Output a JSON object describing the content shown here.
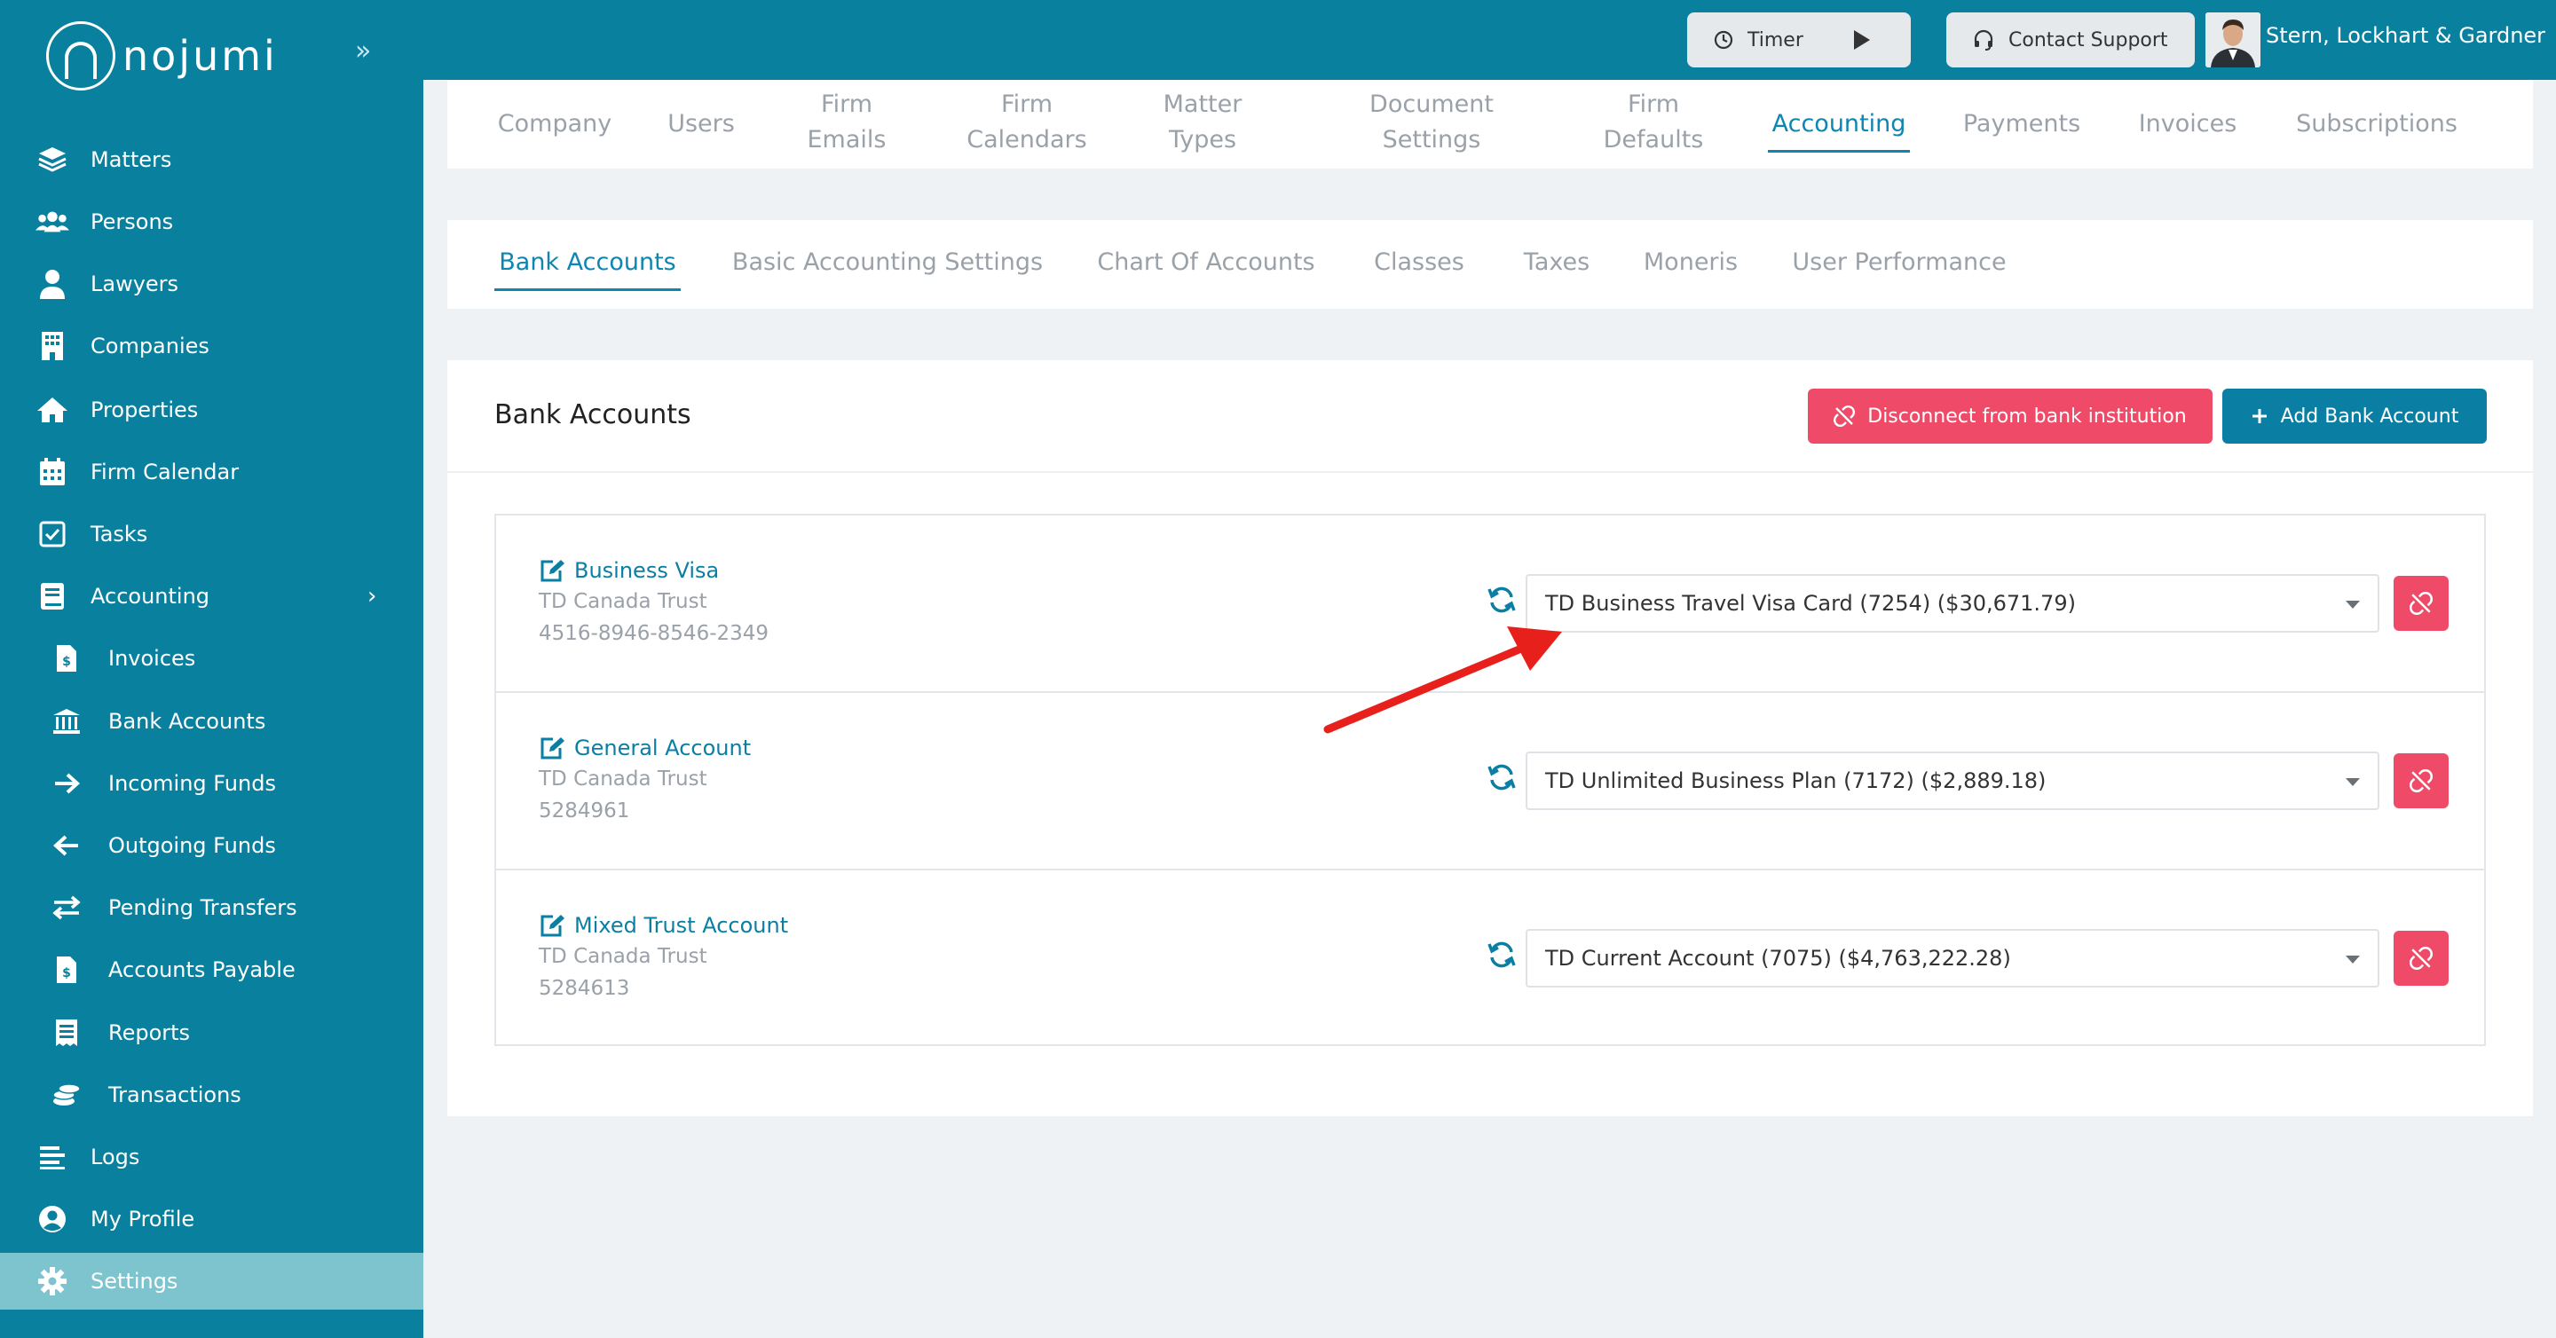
{
  "brand": {
    "logo_text": "nojumi"
  },
  "sidebar": {
    "items": [
      {
        "label": "Matters",
        "icon": "layers-icon"
      },
      {
        "label": "Persons",
        "icon": "users-icon"
      },
      {
        "label": "Lawyers",
        "icon": "lawyer-icon"
      },
      {
        "label": "Companies",
        "icon": "building-icon"
      },
      {
        "label": "Properties",
        "icon": "home-icon"
      },
      {
        "label": "Firm Calendar",
        "icon": "calendar-icon"
      },
      {
        "label": "Tasks",
        "icon": "checkbox-icon"
      },
      {
        "label": "Accounting",
        "icon": "book-icon"
      },
      {
        "label": "Invoices",
        "icon": "invoice-icon"
      },
      {
        "label": "Bank Accounts",
        "icon": "bank-icon"
      },
      {
        "label": "Incoming Funds",
        "icon": "arrow-right-icon"
      },
      {
        "label": "Outgoing Funds",
        "icon": "arrow-left-icon"
      },
      {
        "label": "Pending Transfers",
        "icon": "transfer-icon"
      },
      {
        "label": "Accounts Payable",
        "icon": "payable-icon"
      },
      {
        "label": "Reports",
        "icon": "receipt-icon"
      },
      {
        "label": "Transactions",
        "icon": "coins-icon"
      },
      {
        "label": "Logs",
        "icon": "list-icon"
      },
      {
        "label": "My Profile",
        "icon": "profile-icon"
      },
      {
        "label": "Settings",
        "icon": "gear-icon"
      }
    ]
  },
  "topbar": {
    "timer_label": "Timer",
    "support_label": "Contact Support",
    "firm_name": "Stern, Lockhart & Gardner"
  },
  "settings_tabs": [
    {
      "line1": "Company",
      "line2": ""
    },
    {
      "line1": "Users",
      "line2": ""
    },
    {
      "line1": "Firm",
      "line2": "Emails"
    },
    {
      "line1": "Firm",
      "line2": "Calendars"
    },
    {
      "line1": "Matter",
      "line2": "Types"
    },
    {
      "line1": "Document",
      "line2": "Settings"
    },
    {
      "line1": "Firm",
      "line2": "Defaults"
    },
    {
      "line1": "Accounting",
      "line2": ""
    },
    {
      "line1": "Payments",
      "line2": ""
    },
    {
      "line1": "Invoices",
      "line2": ""
    },
    {
      "line1": "Subscriptions",
      "line2": ""
    }
  ],
  "accounting_tabs": [
    "Bank Accounts",
    "Basic Accounting Settings",
    "Chart Of Accounts",
    "Classes",
    "Taxes",
    "Moneris",
    "User Performance"
  ],
  "main": {
    "title": "Bank Accounts",
    "disconnect_label": "Disconnect from bank institution",
    "add_label": "Add Bank Account"
  },
  "accounts": [
    {
      "name": "Business Visa",
      "bank": "TD Canada Trust",
      "number": "4516-8946-8546-2349",
      "linked": "TD Business Travel Visa Card (7254) ($30,671.79)"
    },
    {
      "name": "General Account",
      "bank": "TD Canada Trust",
      "number": "5284961",
      "linked": "TD Unlimited Business Plan (7172) ($2,889.18)"
    },
    {
      "name": "Mixed Trust Account",
      "bank": "TD Canada Trust",
      "number": "5284613",
      "linked": "TD Current Account (7075) ($4,763,222.28)"
    }
  ],
  "colors": {
    "teal": "#0a809f",
    "accent": "#0d86b2",
    "danger": "#ef4a68",
    "annotation_arrow": "#e8201c"
  }
}
